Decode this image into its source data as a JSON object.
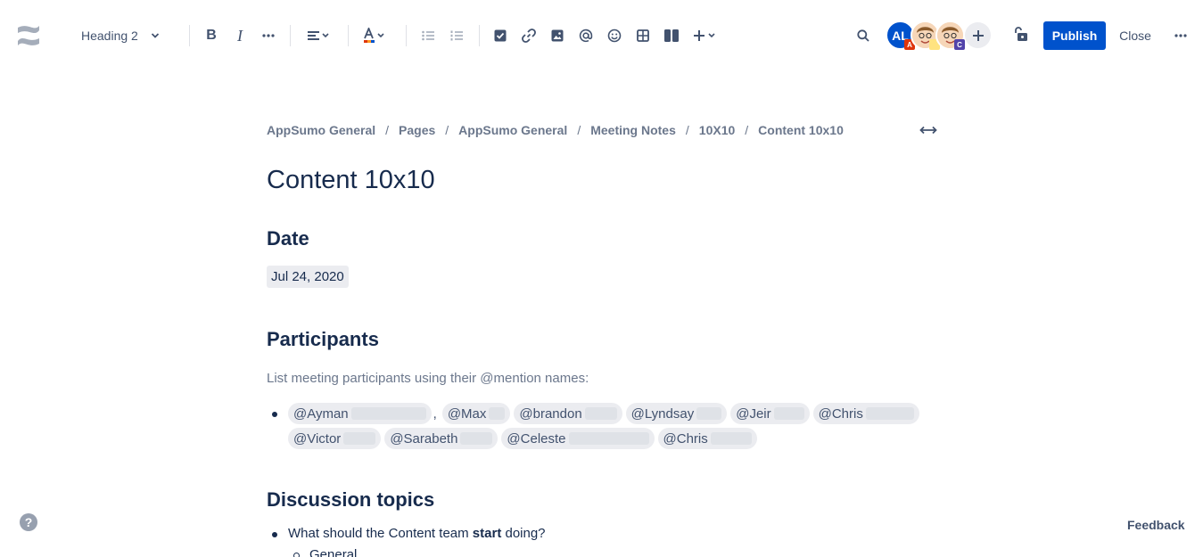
{
  "toolbar": {
    "text_style": "Heading 2",
    "publish_label": "Publish",
    "close_label": "Close",
    "avatars": [
      {
        "initials": "AL",
        "badge": "A",
        "badge_color": "#de350b"
      },
      {
        "badge": "",
        "badge_color": "#ffc400"
      },
      {
        "badge": "C",
        "badge_color": "#5243aa"
      }
    ]
  },
  "breadcrumb": [
    "AppSumo General",
    "Pages",
    "AppSumo General",
    "Meeting Notes",
    "10X10",
    "Content 10x10"
  ],
  "page": {
    "title": "Content 10x10",
    "date_heading": "Date",
    "date_value": "Jul 24, 2020",
    "participants_heading": "Participants",
    "participants_hint": "List meeting participants using their @mention names:",
    "mentions": [
      "@Ayman",
      "@Max",
      "@brandon",
      "@Lyndsay",
      "@Jeir",
      "@Chris",
      "@Victor",
      "@Sarabeth",
      "@Celeste",
      "@Chris"
    ],
    "discussion_heading": "Discussion topics",
    "topic_1_before": "What should the Content team ",
    "topic_1_bold": "start",
    "topic_1_after": " doing?",
    "sub_item": "General"
  },
  "footer": {
    "help_label": "?",
    "feedback_label": "Feedback"
  },
  "colors": {
    "primary": "#0052cc",
    "text": "#172b4d",
    "subtle": "#42526e"
  }
}
